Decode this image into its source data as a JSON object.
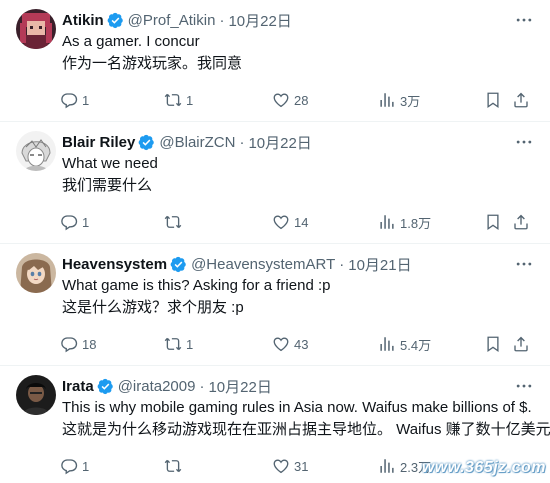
{
  "tweets": [
    {
      "name": "Atikin",
      "verified": true,
      "handle": "@Prof_Atikin",
      "separator": "·",
      "date": "10月22日",
      "line1": "As a gamer. I concur",
      "line2": "作为一名游戏玩家。我同意",
      "replies": "1",
      "retweets": "1",
      "likes": "28",
      "views": "3万",
      "avatar_icon": "avatar-pixel-art"
    },
    {
      "name": "Blair Riley",
      "verified": true,
      "handle": "@BlairZCN",
      "separator": "·",
      "date": "10月22日",
      "line1": "What we need",
      "line2": "我们需要什么",
      "replies": "1",
      "retweets": "",
      "likes": "14",
      "views": "1.8万",
      "avatar_icon": "avatar-anime-sketch"
    },
    {
      "name": "Heavensystem",
      "verified": true,
      "handle": "@HeavensystemART",
      "separator": "·",
      "date": "10月21日",
      "line1": "What game is this? Asking for a friend :p",
      "line2": "这是什么游戏？求个朋友 :p",
      "replies": "18",
      "retweets": "1",
      "likes": "43",
      "views": "5.4万",
      "avatar_icon": "avatar-anime-girl"
    },
    {
      "name": "Irata",
      "verified": true,
      "handle": "@irata2009",
      "separator": "·",
      "date": "10月22日",
      "line1": "This is why mobile gaming rules in Asia now.  Waifus make billions of $.",
      "line2": "这就是为什么移动游戏现在在亚洲占据主导地位。 Waifus 赚了数十亿美元。",
      "replies": "1",
      "retweets": "",
      "likes": "31",
      "views": "2.3万",
      "avatar_icon": "avatar-photo"
    }
  ],
  "watermark": "www.365jz.com",
  "colors": {
    "verified": "#1d9bf0",
    "muted": "#536471",
    "text": "#0f1419",
    "divider": "#eff3f4"
  }
}
